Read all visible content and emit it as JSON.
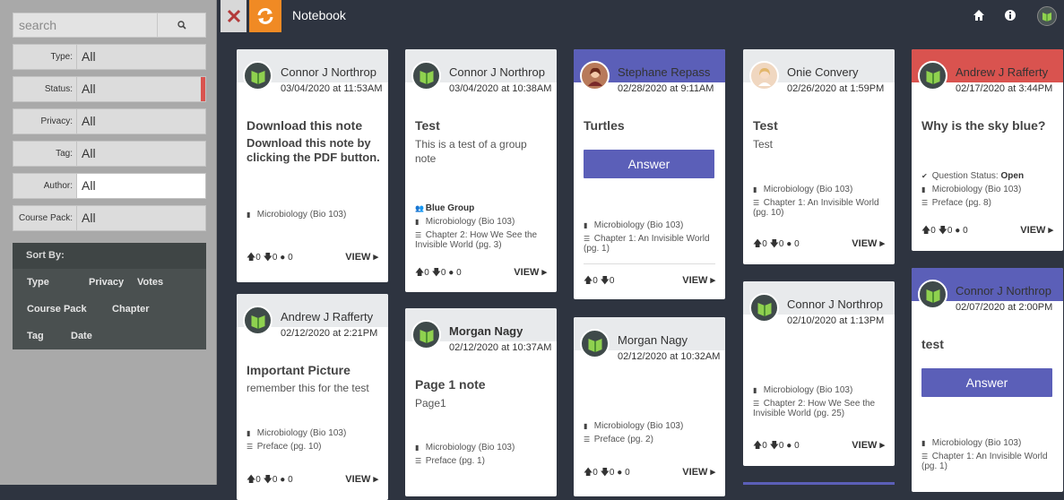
{
  "app": {
    "title": "Notebook"
  },
  "search": {
    "placeholder": "search"
  },
  "filters": [
    {
      "label": "Type:",
      "value": "All"
    },
    {
      "label": "Status:",
      "value": "All"
    },
    {
      "label": "Privacy:",
      "value": "All"
    },
    {
      "label": "Tag:",
      "value": "All"
    },
    {
      "label": "Author:",
      "value": "All"
    },
    {
      "label": "Course Pack:",
      "value": "All"
    }
  ],
  "sort": {
    "title": "Sort By:",
    "items": [
      "Type",
      "Privacy",
      "Votes",
      "Course Pack",
      "Chapter",
      "Tag",
      "Date"
    ]
  },
  "colors": {
    "accent": "#5b5fb8",
    "danger": "#d9534f",
    "orange": "#f08a24",
    "dark": "#2e3440"
  },
  "card_common": {
    "view": "VIEW",
    "answer": "Answer",
    "up": "0",
    "down": "0",
    "comments": "0"
  },
  "cards": [
    {
      "name": "Connor J Northrop",
      "date": "03/04/2020 at 11:53AM",
      "title": "Download this note",
      "body": "Download this note by clicking the PDF button.",
      "course": "Microbiology (Bio 103)"
    },
    {
      "name": "Connor J Northrop",
      "date": "03/04/2020 at 10:38AM",
      "title": "Test",
      "body": "This is a test of a group note",
      "group": "Blue Group",
      "course": "Microbiology (Bio 103)",
      "chapter": "Chapter 2: How We See the Invisible World (pg. 3)"
    },
    {
      "name": "Stephane Repass",
      "date": "02/28/2020 at 9:11AM",
      "title": "Turtles",
      "course": "Microbiology (Bio 103)",
      "chapter": "Chapter 1: An Invisible World (pg. 1)"
    },
    {
      "name": "Onie Convery",
      "date": "02/26/2020 at 1:59PM",
      "title": "Test",
      "body": "Test",
      "course": "Microbiology (Bio 103)",
      "chapter": "Chapter 1: An Invisible World (pg. 10)"
    },
    {
      "name": "Andrew J Rafferty",
      "date": "02/17/2020 at 3:44PM",
      "title": "Why is the sky blue?",
      "status_label": "Question Status:",
      "status": "Open",
      "course": "Microbiology (Bio 103)",
      "chapter": "Preface (pg. 8)"
    },
    {
      "name": "Andrew J Rafferty",
      "date": "02/12/2020 at 2:21PM",
      "title": "Important Picture",
      "body": "remember this for the test",
      "course": "Microbiology (Bio 103)",
      "chapter": "Preface (pg. 10)"
    },
    {
      "name": "Morgan Nagy",
      "date": "02/12/2020 at 10:37AM",
      "title": "Page 1 note",
      "body": "Page1",
      "course": "Microbiology (Bio 103)",
      "chapter": "Preface (pg. 1)"
    },
    {
      "name": "Morgan Nagy",
      "date": "02/12/2020 at 10:32AM",
      "course": "Microbiology (Bio 103)",
      "chapter": "Preface (pg. 2)"
    },
    {
      "name": "Connor J Northrop",
      "date": "02/10/2020 at 1:13PM",
      "course": "Microbiology (Bio 103)",
      "chapter": "Chapter 2: How We See the Invisible World (pg. 25)"
    },
    {
      "name": "Connor J Northrop",
      "date": "02/07/2020 at 2:00PM",
      "title": "test",
      "course": "Microbiology (Bio 103)",
      "chapter": "Chapter 1: An Invisible World (pg. 1)"
    }
  ]
}
